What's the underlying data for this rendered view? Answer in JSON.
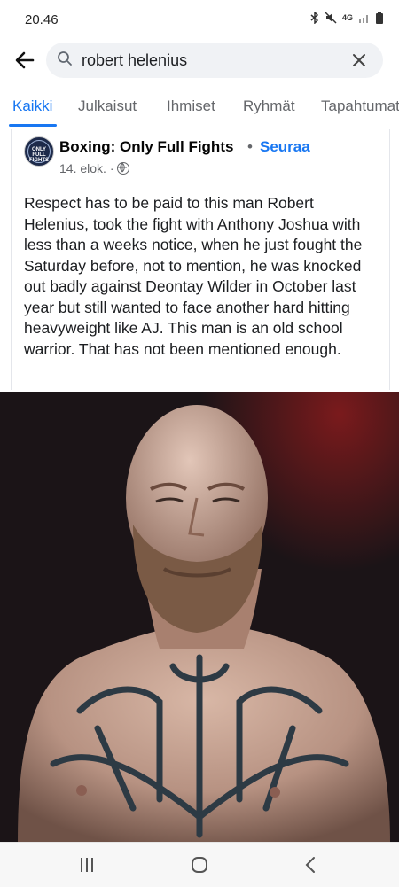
{
  "status_bar": {
    "time": "20.46",
    "network": "4G"
  },
  "search": {
    "query": "robert helenius"
  },
  "tabs": [
    {
      "label": "Kaikki",
      "active": true
    },
    {
      "label": "Julkaisut",
      "active": false
    },
    {
      "label": "Ihmiset",
      "active": false
    },
    {
      "label": "Ryhmät",
      "active": false
    },
    {
      "label": "Tapahtumat",
      "active": false
    }
  ],
  "post": {
    "page_name": "Boxing: Only Full Fights",
    "separator": "•",
    "follow_label": "Seuraa",
    "date": "14. elok. ·",
    "text": "Respect has to be paid to this man Robert Helenius, took the fight with Anthony Joshua with less than a weeks notice, when he just fought the Saturday before, not to mention, he was knocked out badly against Deontay Wilder in October last year but still wanted to face another hard hitting heavyweight like AJ. This man is an old school warrior. That has not been mentioned enough.",
    "avatar_text": "ONLY FULL FIGHTS"
  },
  "colors": {
    "accent": "#1877f2",
    "muted": "#65676b"
  },
  "icons": {
    "back": "back-arrow-icon",
    "search": "search-icon",
    "clear": "close-icon",
    "globe": "globe-icon",
    "nav_recent": "recent-apps-icon",
    "nav_home": "home-icon",
    "nav_back": "nav-back-icon"
  }
}
